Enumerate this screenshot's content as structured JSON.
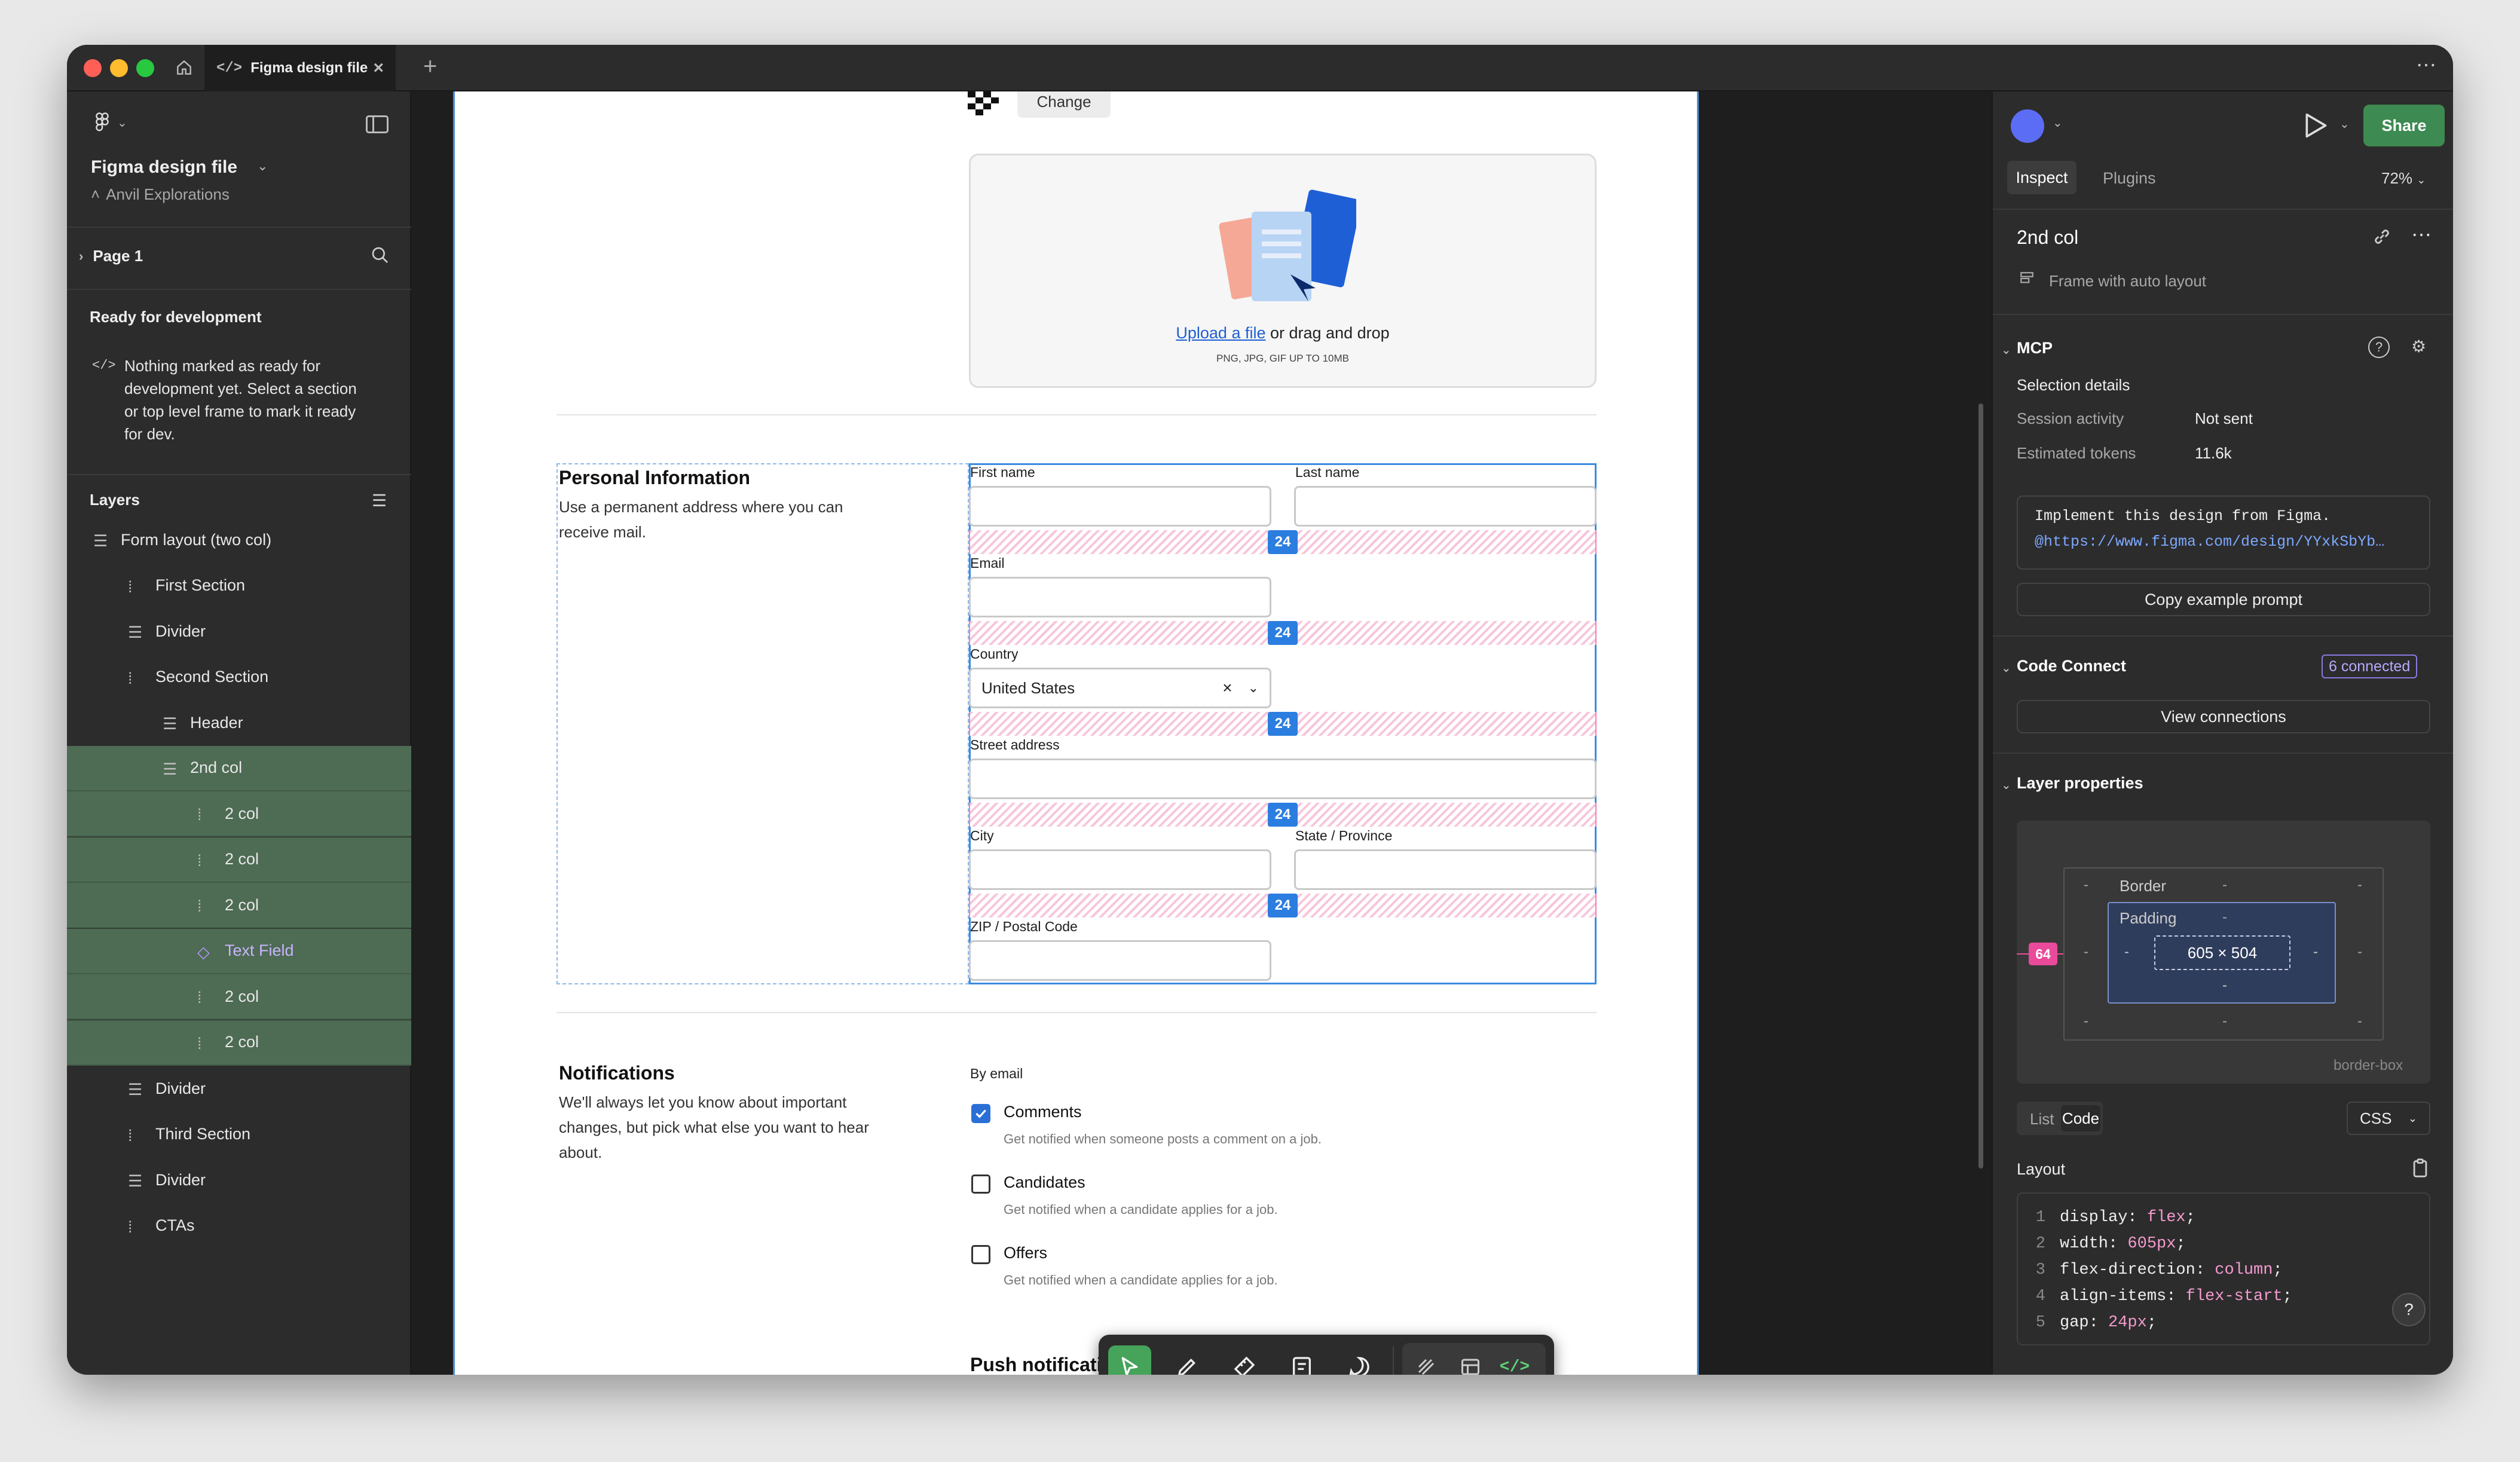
{
  "window": {
    "tab_title": "Figma design file",
    "new_tab": "+",
    "more": "⋯"
  },
  "left": {
    "file_name": "Figma design file",
    "project": "Anvil Explorations",
    "page": "Page 1",
    "ready_title": "Ready for development",
    "ready_text": "Nothing marked as ready for development yet. Select a section or top level frame to mark it ready for dev.",
    "layers_title": "Layers",
    "layers": [
      {
        "label": "Form layout (two col)",
        "icon": "frame-icon"
      },
      {
        "label": "First Section",
        "icon": "autolayout-icon"
      },
      {
        "label": "Divider",
        "icon": "frame-icon"
      },
      {
        "label": "Second Section",
        "icon": "autolayout-icon"
      },
      {
        "label": "Header",
        "icon": "frame-icon"
      },
      {
        "label": "2nd col",
        "icon": "frame-icon"
      },
      {
        "label": "2 col",
        "icon": "autolayout-icon"
      },
      {
        "label": "2 col",
        "icon": "autolayout-icon"
      },
      {
        "label": "2 col",
        "icon": "autolayout-icon"
      },
      {
        "label": "Text Field",
        "icon": "component-icon"
      },
      {
        "label": "2 col",
        "icon": "autolayout-icon"
      },
      {
        "label": "2 col",
        "icon": "autolayout-icon"
      },
      {
        "label": "Divider",
        "icon": "frame-icon"
      },
      {
        "label": "Third Section",
        "icon": "autolayout-icon"
      },
      {
        "label": "Divider",
        "icon": "frame-icon"
      },
      {
        "label": "CTAs",
        "icon": "autolayout-icon"
      }
    ]
  },
  "design": {
    "change_button": "Change",
    "upload_link": "Upload a file",
    "upload_rest": " or drag and drop",
    "upload_hint": "PNG, JPG, GIF UP TO 10MB",
    "section_title": "Personal Information",
    "section_desc": "Use a permanent address where you can receive mail.",
    "fields": {
      "first_name": "First name",
      "last_name": "Last name",
      "email": "Email",
      "country": "Country",
      "country_value": "United States",
      "street": "Street address",
      "city": "City",
      "state": "State / Province",
      "zip": "ZIP / Postal Code"
    },
    "gap_badge": "24",
    "notif_title": "Notifications",
    "notif_desc": "We'll always let you know about important changes, but pick what else you want to hear about.",
    "by_email": "By email",
    "options": [
      {
        "label": "Comments",
        "desc": "Get notified when someone posts a comment on a job.",
        "checked": true
      },
      {
        "label": "Candidates",
        "desc": "Get notified when a candidate applies for a job.",
        "checked": false
      },
      {
        "label": "Offers",
        "desc": "Get notified when a candidate applies for a job.",
        "checked": false
      }
    ],
    "push_title": "Push notifications"
  },
  "right": {
    "share": "Share",
    "tab_inspect": "Inspect",
    "tab_plugins": "Plugins",
    "zoom": "72%",
    "layer_name": "2nd col",
    "layer_type": "Frame with auto layout",
    "mcp_title": "MCP",
    "selection_details": "Selection details",
    "session_label": "Session activity",
    "session_value": "Not sent",
    "tokens_label": "Estimated tokens",
    "tokens_value": "11.6k",
    "prompt_line1": "Implement this design from Figma.",
    "prompt_line2": "@https://www.figma.com/design/YYxkSbYb…",
    "copy_prompt": "Copy example prompt",
    "code_connect": "Code Connect",
    "connected_badge": "6 connected",
    "view_connections": "View connections",
    "layer_props": "Layer properties",
    "box": {
      "border": "Border",
      "padding": "Padding",
      "size": "605 × 504",
      "margin_left": "64",
      "dash": "-",
      "box_sizing": "border-box"
    },
    "view_list": "List",
    "view_code": "Code",
    "lang": "CSS",
    "layout_title": "Layout",
    "code_lines": [
      {
        "n": "1",
        "prop": "display: ",
        "val": "flex",
        "end": ";"
      },
      {
        "n": "2",
        "prop": "width: ",
        "val": "605px",
        "end": ";"
      },
      {
        "n": "3",
        "prop": "flex-direction: ",
        "val": "column",
        "end": ";"
      },
      {
        "n": "4",
        "prop": "align-items: ",
        "val": "flex-start",
        "end": ";"
      },
      {
        "n": "5",
        "prop": "gap: ",
        "val": "24px",
        "end": ";"
      }
    ],
    "help": "?"
  }
}
